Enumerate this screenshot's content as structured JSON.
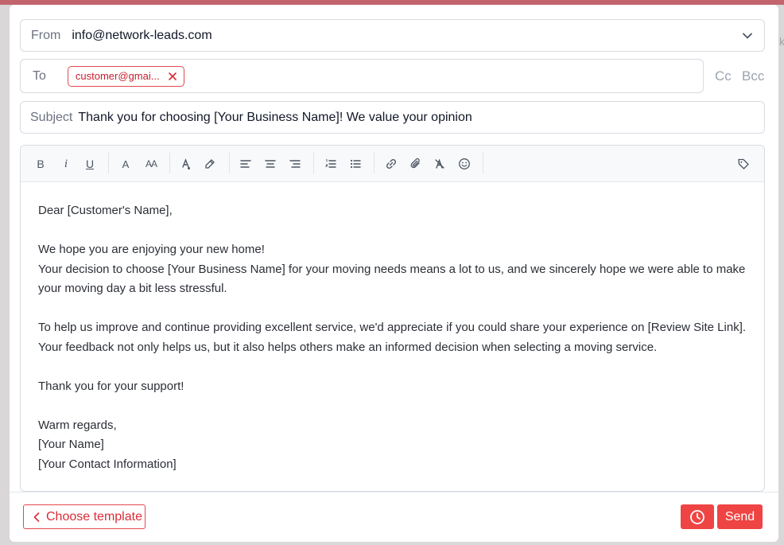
{
  "from": {
    "label": "From",
    "value": "info@network-leads.com"
  },
  "to": {
    "label": "To",
    "recipients": [
      "customer@gmai..."
    ]
  },
  "cc_label": "Cc",
  "bcc_label": "Bcc",
  "subject": {
    "label": "Subject",
    "value": "Thank you for choosing [Your Business Name]! We value your opinion"
  },
  "toolbar": {
    "icons": [
      "bold-icon",
      "italic-icon",
      "underline-icon",
      "font-icon",
      "font-size-icon",
      "text-color-icon",
      "highlight-icon",
      "align-left-icon",
      "align-center-icon",
      "align-right-icon",
      "ordered-list-icon",
      "bullet-list-icon",
      "link-icon",
      "attachment-icon",
      "clear-format-icon",
      "emoji-icon",
      "tag-icon"
    ],
    "bold": "B",
    "italic": "i",
    "underline": "U",
    "font": "A",
    "font_size": "AA"
  },
  "body": {
    "greeting": "Dear [Customer's Name],",
    "p1_l1": "We hope you are enjoying your new home!",
    "p1_l2": "Your decision to choose [Your Business Name] for your moving needs means a lot to us, and we sincerely hope we were able to make your moving day a bit less stressful.",
    "p2": "To help us improve and continue providing excellent service, we'd appreciate if you could share your experience on [Review Site Link]. Your feedback not only helps us, but it also helps others make an informed decision when selecting a moving service.",
    "thanks": "Thank you for your support!",
    "sign_1": "Warm regards,",
    "sign_2": "[Your Name]",
    "sign_3": "[Your Contact Information]"
  },
  "footer": {
    "choose_template": "Choose template",
    "send": "Send"
  },
  "colors": {
    "accent": "#ef4444",
    "chip_text": "#c81e2c",
    "border": "#d7dbe1",
    "muted": "#9ca3af"
  }
}
